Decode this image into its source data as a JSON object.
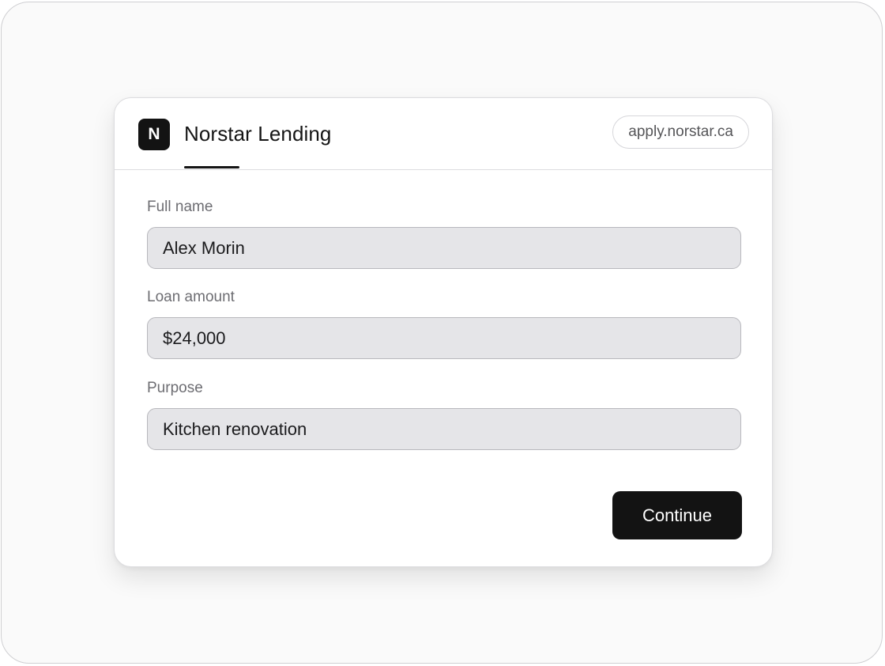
{
  "app": {
    "logo_letter": "N",
    "brand_name": "Norstar Lending",
    "url": "apply.norstar.ca"
  },
  "form": {
    "fields": [
      {
        "label": "Full name",
        "value": "Alex Morin"
      },
      {
        "label": "Loan amount",
        "value": "$24,000"
      },
      {
        "label": "Purpose",
        "value": "Kitchen renovation"
      }
    ],
    "continue_label": "Continue"
  },
  "colors": {
    "accent": "#131313",
    "input_background": "#e5e5e8",
    "page_background": "#fafafa"
  }
}
